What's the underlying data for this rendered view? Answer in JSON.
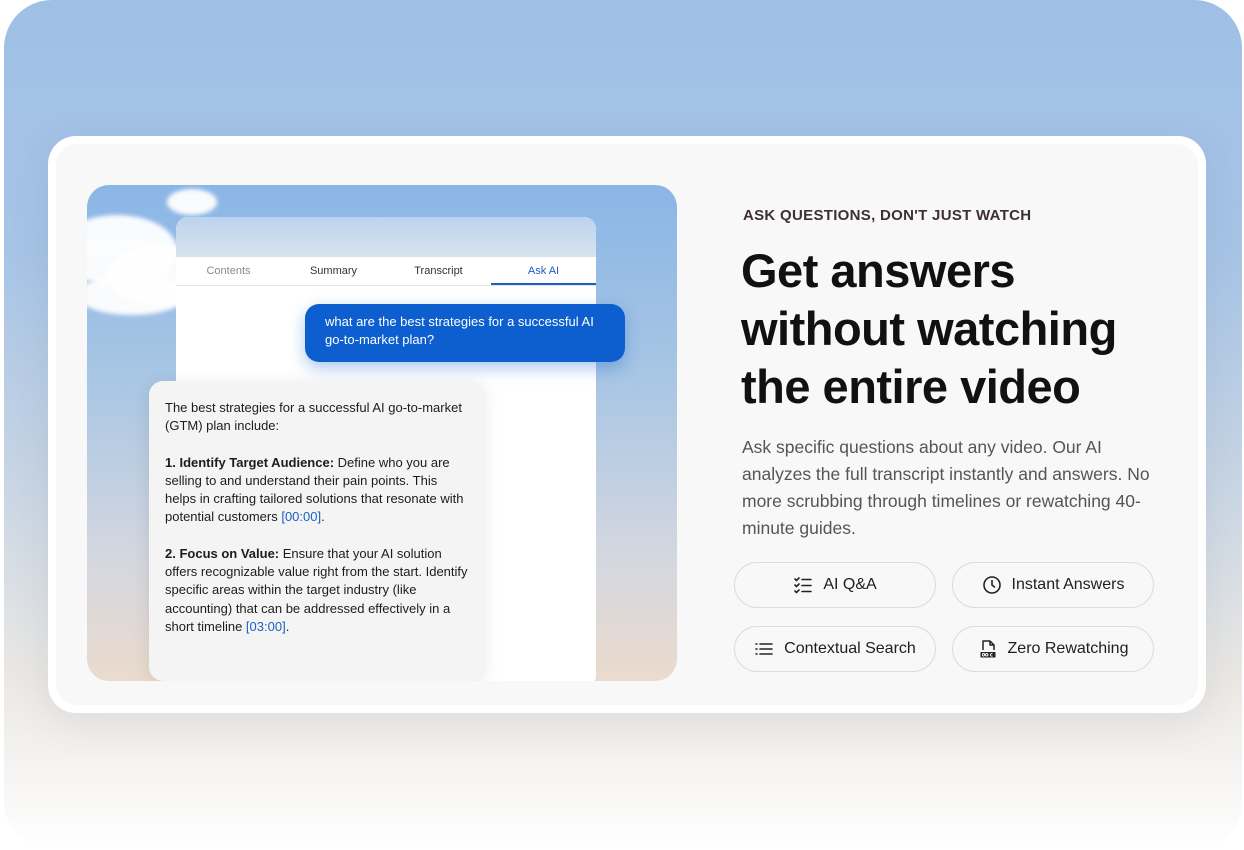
{
  "illustration": {
    "tabs": [
      "Contents",
      "Summary",
      "Transcript",
      "Ask AI"
    ],
    "active_tab": "Ask AI",
    "question": "what are the best strategies for a successful AI go-to-market plan?",
    "answer": {
      "intro": "The best strategies for a successful AI go-to-market (GTM) plan include:",
      "points": [
        {
          "title": "1. Identify Target Audience:",
          "body": " Define who you are selling to and understand their pain points. This helps in crafting tailored solutions that resonate with potential customers ",
          "timestamp": "[00:00]"
        },
        {
          "title": "2. Focus on Value:",
          "body": " Ensure that your AI solution offers recognizable value right from the start. Identify specific areas within the target industry (like accounting) that can be addressed effectively in a short timeline ",
          "timestamp": "[03:00]"
        }
      ]
    }
  },
  "content": {
    "eyebrow": "ASK QUESTIONS, DON'T JUST WATCH",
    "headline": "Get answers without watching the entire video",
    "description": "Ask specific questions about any video. Our AI analyzes the full transcript instantly and answers. No more scrubbing through timelines or rewatching 40-minute guides.",
    "features": [
      {
        "label": "AI Q&A",
        "icon": "checklist-icon"
      },
      {
        "label": "Instant Answers",
        "icon": "clock-icon"
      },
      {
        "label": "Contextual Search",
        "icon": "list-icon"
      },
      {
        "label": "Zero Rewatching",
        "icon": "doc-icon"
      }
    ]
  },
  "colors": {
    "accent": "#0d5fcf",
    "timestamp": "#1a5fc2"
  }
}
